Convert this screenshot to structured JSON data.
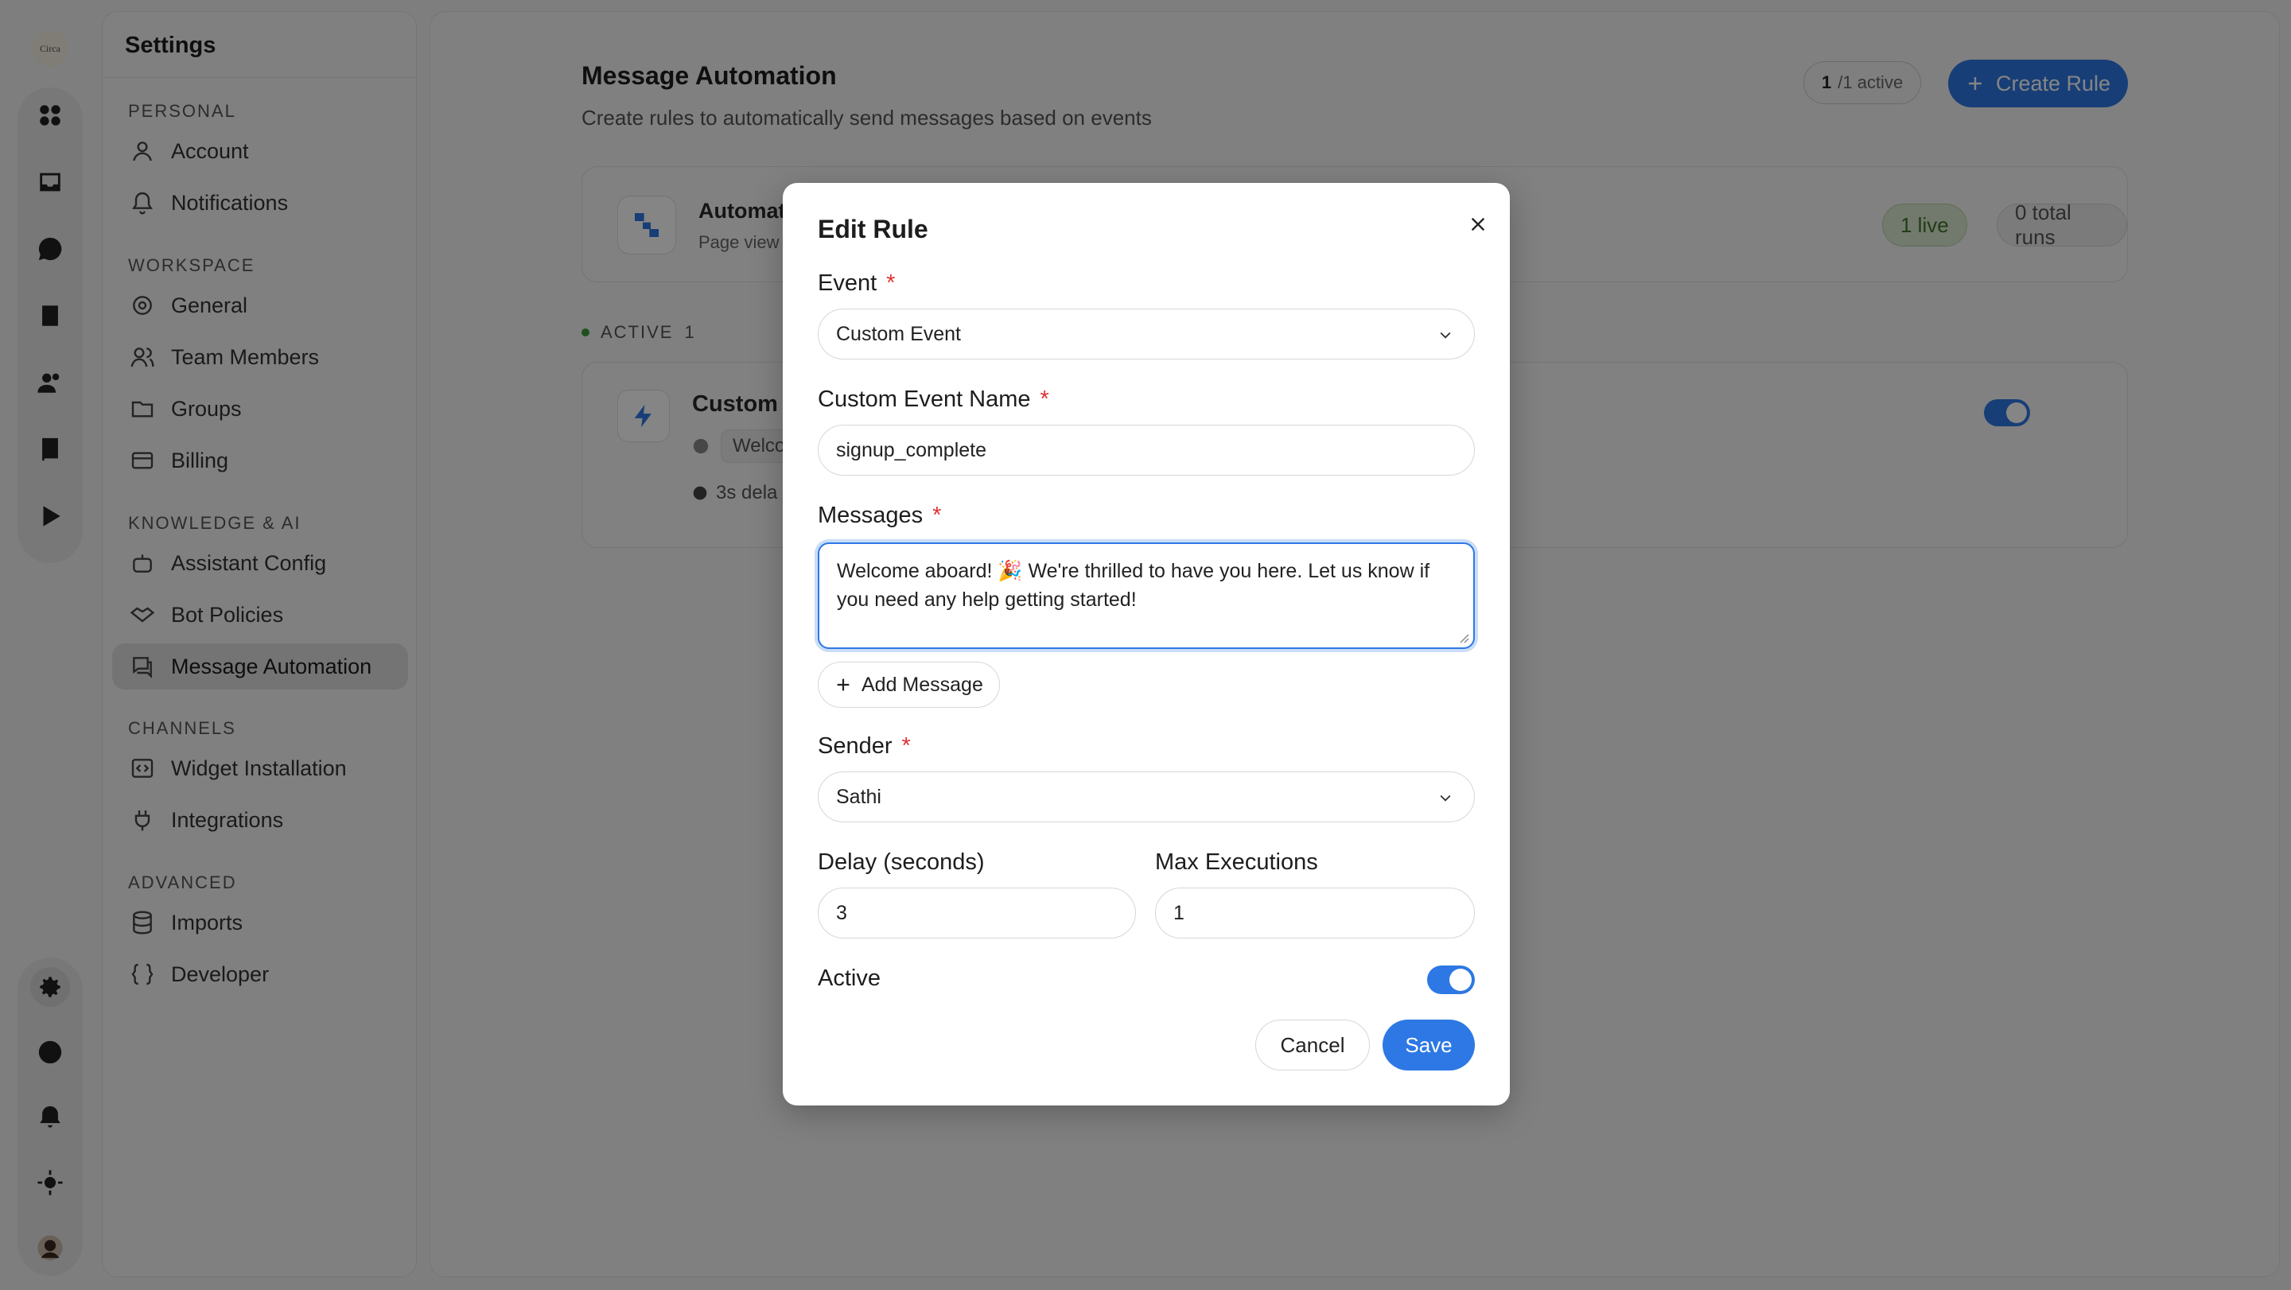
{
  "rail": {
    "logo_text": "Circa",
    "top_icons": [
      "apps-icon",
      "inbox-icon",
      "ai-chat-icon",
      "tasks-icon",
      "users-icon",
      "book-icon",
      "play-icon"
    ],
    "bottom_icons": [
      "settings-icon",
      "help-icon",
      "bell-icon",
      "sun-icon",
      "user-avatar"
    ]
  },
  "settings": {
    "title": "Settings",
    "sections": [
      {
        "label": "PERSONAL",
        "items": [
          {
            "label": "Account",
            "icon": "user-icon"
          },
          {
            "label": "Notifications",
            "icon": "bell-icon"
          }
        ]
      },
      {
        "label": "WORKSPACE",
        "items": [
          {
            "label": "General",
            "icon": "gear-icon"
          },
          {
            "label": "Team Members",
            "icon": "team-icon"
          },
          {
            "label": "Groups",
            "icon": "folder-icon"
          },
          {
            "label": "Billing",
            "icon": "billing-icon"
          }
        ]
      },
      {
        "label": "KNOWLEDGE & AI",
        "items": [
          {
            "label": "Assistant Config",
            "icon": "bot-icon"
          },
          {
            "label": "Bot Policies",
            "icon": "handshake-icon"
          },
          {
            "label": "Message Automation",
            "icon": "messages-icon",
            "active": true
          }
        ]
      },
      {
        "label": "CHANNELS",
        "items": [
          {
            "label": "Widget Installation",
            "icon": "code-icon"
          },
          {
            "label": "Integrations",
            "icon": "plug-icon"
          }
        ]
      },
      {
        "label": "ADVANCED",
        "items": [
          {
            "label": "Imports",
            "icon": "database-icon"
          },
          {
            "label": "Developer",
            "icon": "braces-icon"
          }
        ]
      }
    ]
  },
  "main": {
    "title": "Message Automation",
    "subtitle": "Create rules to automatically send messages based on events",
    "count_number": "1",
    "count_suffix": "/1 active",
    "create_label": "Create Rule",
    "summary": {
      "title": "Automat",
      "subtitle": "Page view",
      "live": "1 live",
      "runs": "0 total runs"
    },
    "active_section": {
      "label": "ACTIVE",
      "count": "1"
    },
    "rule": {
      "title": "Custom",
      "message_chip": "Welco",
      "delay": "3s dela"
    }
  },
  "modal": {
    "title": "Edit Rule",
    "event_label": "Event",
    "event_value": "Custom Event",
    "custom_event_label": "Custom Event Name",
    "custom_event_value": "signup_complete",
    "messages_label": "Messages",
    "message_text": "Welcome aboard! 🎉 We're thrilled to have you here. Let us know if you need any help getting started!",
    "add_message_label": "Add Message",
    "sender_label": "Sender",
    "sender_value": "Sathi",
    "delay_label": "Delay (seconds)",
    "delay_value": "3",
    "max_exec_label": "Max Executions",
    "max_exec_value": "1",
    "active_label": "Active",
    "active_on": true,
    "required_mark": "*",
    "cancel_label": "Cancel",
    "save_label": "Save"
  },
  "colors": {
    "accent": "#2d78e4",
    "required": "#dd3333",
    "live_green": "#3f7a2a"
  }
}
